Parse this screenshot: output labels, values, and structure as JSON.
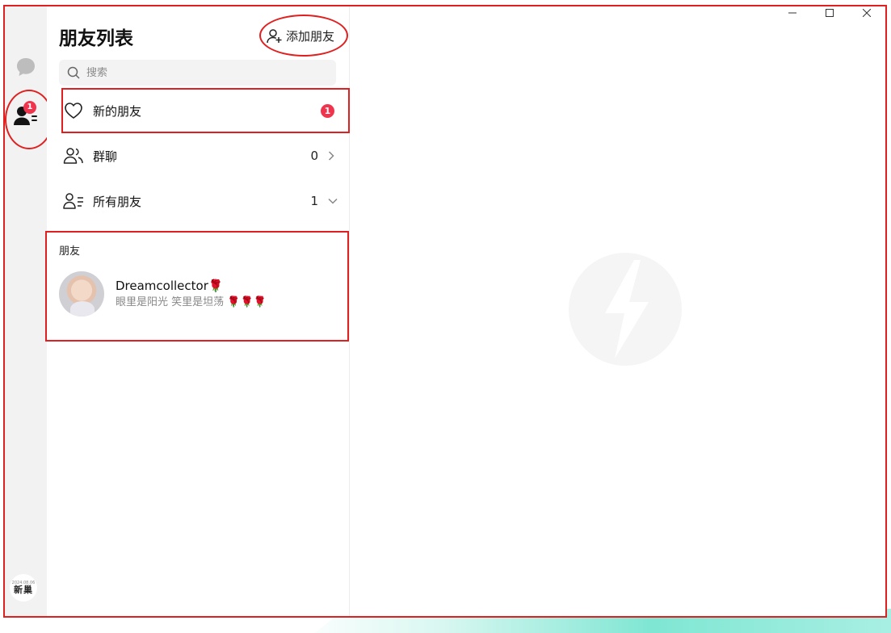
{
  "rail": {
    "friends_badge": "1",
    "logo_top": "2024.08.06",
    "logo_text": "新巢"
  },
  "list": {
    "title": "朋友列表",
    "add_friend_label": "添加朋友",
    "search_placeholder": "搜索"
  },
  "rows": {
    "new_friends": {
      "label": "新的朋友",
      "badge": "1"
    },
    "group_chats": {
      "label": "群聊",
      "count": "0"
    },
    "all_friends": {
      "label": "所有朋友",
      "count": "1"
    }
  },
  "friends_section": {
    "title": "朋友",
    "items": [
      {
        "name": "Dreamcollector🌹",
        "bio": "眼里是阳光 笑里是坦荡 🌹🌹🌹"
      }
    ]
  },
  "colors": {
    "badge": "#f0344d",
    "annotation": "#e02020",
    "rail_bg": "#f2f2f2"
  }
}
